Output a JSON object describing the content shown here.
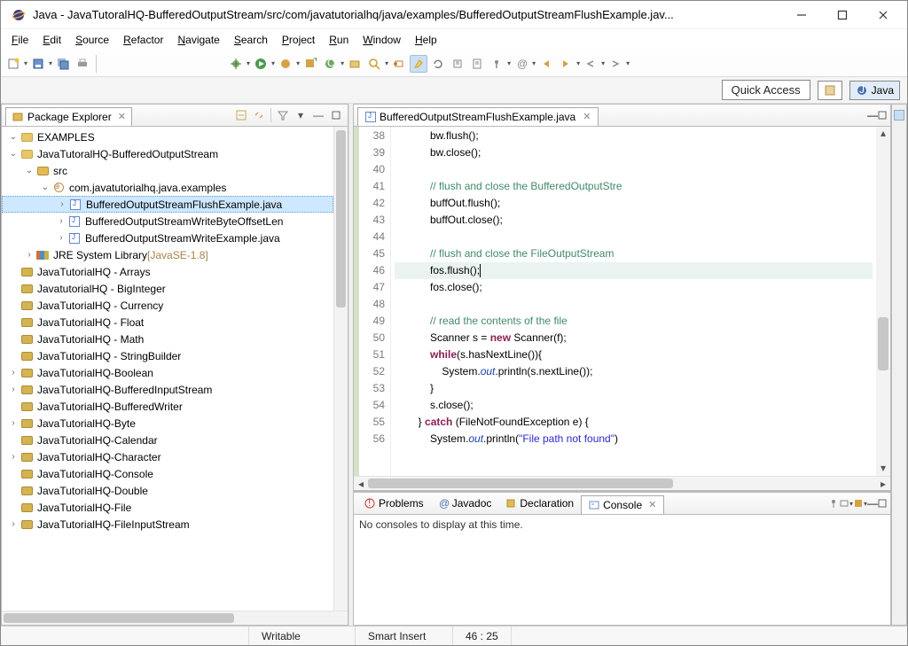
{
  "window": {
    "title": "Java - JavaTutoralHQ-BufferedOutputStream/src/com/javatutorialhq/java/examples/BufferedOutputStreamFlushExample.jav..."
  },
  "menus": [
    "File",
    "Edit",
    "Source",
    "Refactor",
    "Navigate",
    "Search",
    "Project",
    "Run",
    "Window",
    "Help"
  ],
  "quick_access": "Quick Access",
  "perspective_label": "Java",
  "explorer": {
    "title": "Package Explorer",
    "items": [
      {
        "indent": 0,
        "twist": "v",
        "icon": "folder",
        "label": "EXAMPLES"
      },
      {
        "indent": 0,
        "twist": "v",
        "icon": "folder",
        "label": "JavaTutoralHQ-BufferedOutputStream"
      },
      {
        "indent": 1,
        "twist": "v",
        "icon": "src",
        "label": "src"
      },
      {
        "indent": 2,
        "twist": "v",
        "icon": "pkg",
        "label": "com.javatutorialhq.java.examples"
      },
      {
        "indent": 3,
        "twist": ">",
        "icon": "java",
        "label": "BufferedOutputStreamFlushExample.java",
        "sel": true
      },
      {
        "indent": 3,
        "twist": ">",
        "icon": "java",
        "label": "BufferedOutputStreamWriteByteOffsetLen"
      },
      {
        "indent": 3,
        "twist": ">",
        "icon": "java",
        "label": "BufferedOutputStreamWriteExample.java"
      },
      {
        "indent": 1,
        "twist": ">",
        "icon": "lib",
        "label": "JRE System Library ",
        "suffix": "[JavaSE-1.8]"
      },
      {
        "indent": 0,
        "twist": "",
        "icon": "folder-closed",
        "label": "JavaTutorialHQ - Arrays"
      },
      {
        "indent": 0,
        "twist": "",
        "icon": "folder-closed",
        "label": "JavatutorialHQ - BigInteger"
      },
      {
        "indent": 0,
        "twist": "",
        "icon": "folder-closed",
        "label": "JavaTutorialHQ - Currency"
      },
      {
        "indent": 0,
        "twist": "",
        "icon": "folder-closed",
        "label": "JavaTutorialHQ - Float"
      },
      {
        "indent": 0,
        "twist": "",
        "icon": "folder-closed",
        "label": "JavaTutorialHQ - Math"
      },
      {
        "indent": 0,
        "twist": "",
        "icon": "folder-closed",
        "label": "JavaTutorialHQ - StringBuilder"
      },
      {
        "indent": 0,
        "twist": ">",
        "icon": "folder-closed",
        "label": "JavaTutorialHQ-Boolean"
      },
      {
        "indent": 0,
        "twist": ">",
        "icon": "folder-closed",
        "label": "JavaTutorialHQ-BufferedInputStream"
      },
      {
        "indent": 0,
        "twist": "",
        "icon": "folder-closed",
        "label": "JavaTutorialHQ-BufferedWriter"
      },
      {
        "indent": 0,
        "twist": ">",
        "icon": "folder-closed",
        "label": "JavaTutorialHQ-Byte"
      },
      {
        "indent": 0,
        "twist": "",
        "icon": "folder-closed",
        "label": "JavaTutorialHQ-Calendar"
      },
      {
        "indent": 0,
        "twist": ">",
        "icon": "folder-closed",
        "label": "JavaTutorialHQ-Character"
      },
      {
        "indent": 0,
        "twist": "",
        "icon": "folder-closed",
        "label": "JavaTutorialHQ-Console"
      },
      {
        "indent": 0,
        "twist": "",
        "icon": "folder-closed",
        "label": "JavaTutorialHQ-Double"
      },
      {
        "indent": 0,
        "twist": "",
        "icon": "folder-closed",
        "label": "JavaTutorialHQ-File"
      },
      {
        "indent": 0,
        "twist": ">",
        "icon": "folder-closed",
        "label": "JavaTutorialHQ-FileInputStream"
      }
    ]
  },
  "editor": {
    "tab_label": "BufferedOutputStreamFlushExample.java",
    "line_start": 38,
    "line_end": 56,
    "cursor_line": 46,
    "lines_html": [
      "            bw.flush();",
      "            bw.close();",
      "",
      "            <span class='c-com'>// flush and close the BufferedOutputStre</span>",
      "            buffOut.flush();",
      "            buffOut.close();",
      "",
      "            <span class='c-com'>// flush and close the FileOutputStream</span>",
      "            fos.flush();<span class='cursor'></span>",
      "            fos.close();",
      "",
      "            <span class='c-com'>// read the contents of the file</span>",
      "            Scanner s = <span class='c-kw'>new</span> Scanner(f);",
      "            <span class='c-kw'>while</span>(s.hasNextLine()){",
      "                System.<span class='c-stat'>out</span>.println(s.nextLine());",
      "            }",
      "            s.close();",
      "        } <span class='c-kw'>catch</span> (FileNotFoundException e) {",
      "            System.<span class='c-stat'>out</span>.println(<span class='c-str'>\"File path not found\"</span>)"
    ]
  },
  "bottom_tabs": {
    "problems": "Problems",
    "javadoc": "Javadoc",
    "declaration": "Declaration",
    "console": "Console"
  },
  "console_msg": "No consoles to display at this time.",
  "status": {
    "writable": "Writable",
    "insert": "Smart Insert",
    "pos": "46 : 25"
  }
}
